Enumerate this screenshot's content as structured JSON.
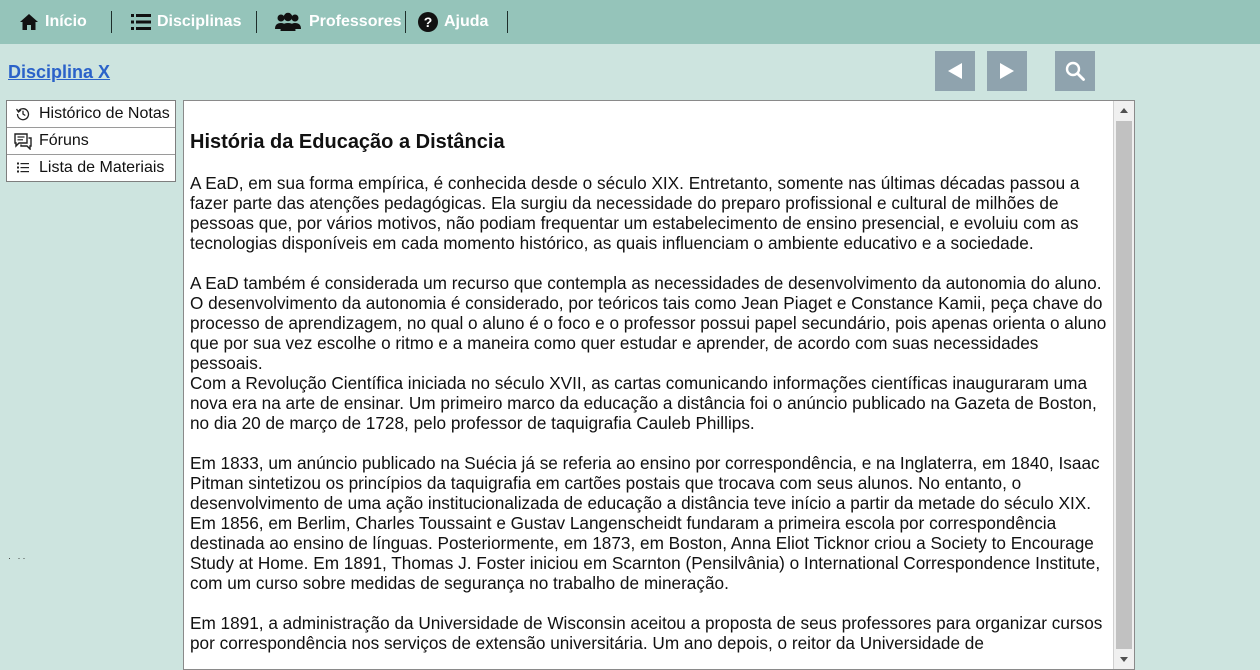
{
  "nav": {
    "home_label": "Início",
    "subjects_label": "Disciplinas",
    "teachers_label": "Professores",
    "help_label": "Ajuda"
  },
  "subject": {
    "title": "Disciplina X"
  },
  "controls": {
    "prev_icon": "triangle-left-icon",
    "next_icon": "triangle-right-icon",
    "search_icon": "search-icon"
  },
  "side_menu": {
    "items": [
      {
        "label": "Histórico de Notas",
        "icon": "history-icon"
      },
      {
        "label": "Fóruns",
        "icon": "forum-icon"
      },
      {
        "label": "Lista de Materiais",
        "icon": "list-icon"
      }
    ]
  },
  "article": {
    "title": "História da Educação a Distância",
    "p1": "A EaD, em sua forma empírica, é conhecida desde o século XIX. Entretanto, somente nas últimas décadas passou a fazer parte das atenções pedagógicas. Ela surgiu da necessidade do preparo profissional e cultural de milhões de pessoas que, por vários motivos, não podiam frequentar um estabelecimento de ensino presencial, e evoluiu com as tecnologias disponíveis em cada momento histórico, as quais influenciam o ambiente educativo e a sociedade.",
    "p2": "A EaD também é considerada um recurso que contempla as necessidades de desenvolvimento da autonomia do aluno. O desenvolvimento da autonomia é considerado, por teóricos tais como Jean Piaget e Constance Kamii, peça chave do processo de aprendizagem, no qual o aluno é o foco e o professor possui papel secundário, pois apenas orienta o aluno que por sua vez escolhe o ritmo e a maneira como quer estudar e aprender, de acordo com suas necessidades pessoais.",
    "p3": "Com a Revolução Científica iniciada no século XVII, as cartas comunicando informações científicas inauguraram uma nova era na arte de ensinar. Um primeiro marco da educação a distância foi o anúncio publicado na Gazeta de Boston, no dia 20 de março de 1728, pelo professor de taquigrafia Cauleb Phillips.",
    "p4": "Em 1833, um anúncio publicado na Suécia já se referia ao ensino por correspondência, e na Inglaterra, em 1840, Isaac Pitman sintetizou os princípios da taquigrafia em cartões postais que trocava com seus alunos. No entanto, o desenvolvimento de uma ação institucionalizada de educação a distância teve início a partir da metade do século XIX. Em 1856, em Berlim, Charles Toussaint e Gustav Langenscheidt fundaram a primeira escola por correspondência destinada ao ensino de línguas. Posteriormente, em 1873, em Boston, Anna Eliot Ticknor criou a Society to Encourage Study at Home. Em 1891, Thomas J. Foster iniciou em Scarnton (Pensilvânia) o International Correspondence Institute, com um curso sobre medidas de segurança no trabalho de mineração.",
    "p5": "Em 1891, a administração da Universidade de Wisconsin aceitou a proposta de seus professores para organizar cursos por correspondência nos serviços de extensão universitária. Um ano depois, o reitor da Universidade de"
  },
  "colors": {
    "nav_bg": "#95c4ba",
    "page_bg": "#cde4df",
    "link": "#2a62c9",
    "control_bg": "#8fa3ae"
  }
}
